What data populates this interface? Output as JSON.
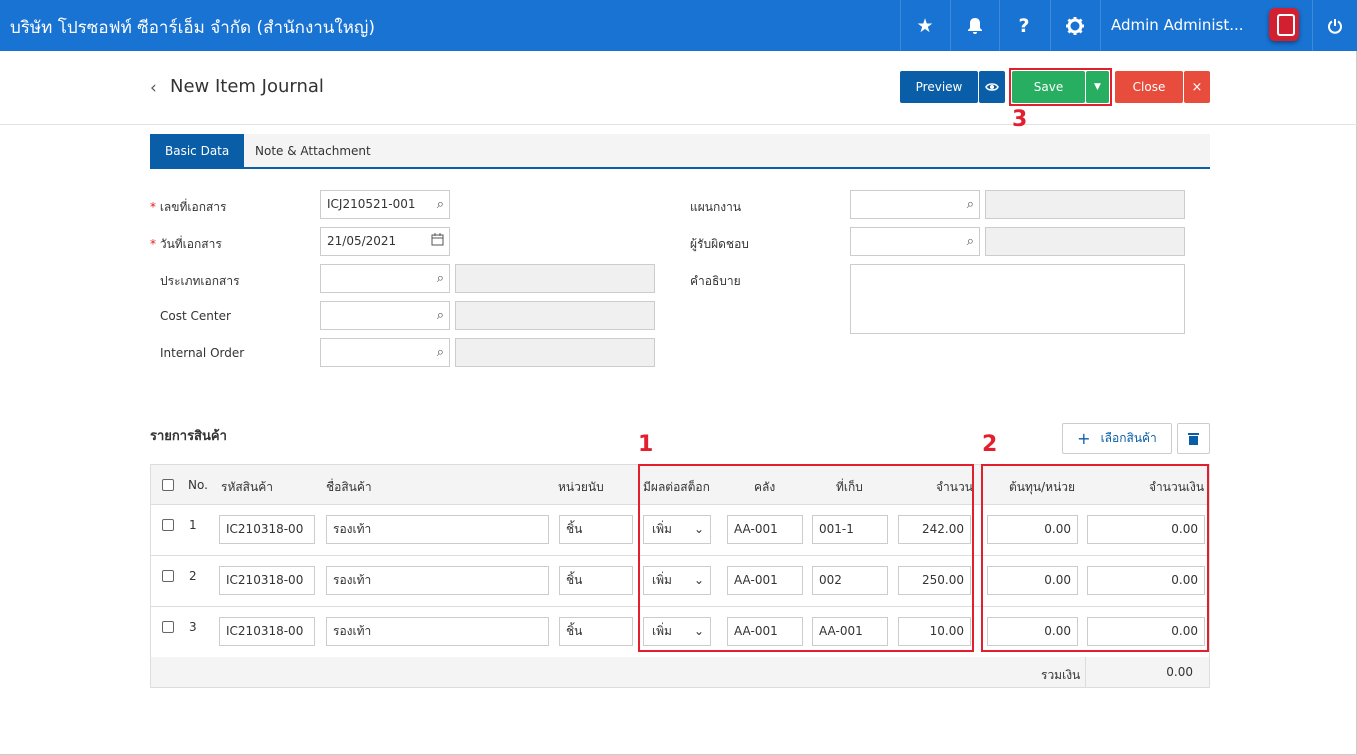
{
  "topbar": {
    "company": "บริษัท โปรซอฟท์ ซีอาร์เอ็ม จำกัด (สำนักงานใหญ่)",
    "user": "Admin Administ...",
    "icons": [
      "star-icon",
      "bell-icon",
      "question-icon",
      "gear-icon",
      "power-icon"
    ]
  },
  "header": {
    "title": "New Item Journal",
    "preview": "Preview",
    "save": "Save",
    "close": "Close"
  },
  "tabs": [
    "Basic Data",
    "Note & Attachment"
  ],
  "form": {
    "doc_no_label": "เลขที่เอกสาร",
    "doc_no": "ICJ210521-001",
    "doc_date_label": "วันที่เอกสาร",
    "doc_date": "21/05/2021",
    "doc_type_label": "ประเภทเอกสาร",
    "cost_center_label": "Cost Center",
    "internal_order_label": "Internal Order",
    "plan_label": "แผนกงาน",
    "responsible_label": "ผู้รับผิดชอบ",
    "description_label": "คำอธิบาย"
  },
  "items": {
    "section_title": "รายการสินค้า",
    "select_button": "เลือกสินค้า",
    "headers": {
      "no": "No.",
      "code": "รหัสสินค้า",
      "name": "ชื่อสินค้า",
      "unit": "หน่วยนับ",
      "effect": "มีผลต่อสต็อก",
      "warehouse": "คลัง",
      "location": "ที่เก็บ",
      "qty": "จำนวน",
      "unit_cost": "ต้นทุน/หน่วย",
      "amount": "จำนวนเงิน"
    },
    "rows": [
      {
        "no": "1",
        "code": "IC210318-00",
        "name": "รองเท้า",
        "unit": "ชิ้น",
        "effect": "เพิ่ม",
        "warehouse": "AA-001",
        "location": "001-1",
        "qty": "242.00",
        "unit_cost": "0.00",
        "amount": "0.00"
      },
      {
        "no": "2",
        "code": "IC210318-00",
        "name": "รองเท้า",
        "unit": "ชิ้น",
        "effect": "เพิ่ม",
        "warehouse": "AA-001",
        "location": "002",
        "qty": "250.00",
        "unit_cost": "0.00",
        "amount": "0.00"
      },
      {
        "no": "3",
        "code": "IC210318-00",
        "name": "รองเท้า",
        "unit": "ชิ้น",
        "effect": "เพิ่ม",
        "warehouse": "AA-001",
        "location": "AA-001",
        "qty": "10.00",
        "unit_cost": "0.00",
        "amount": "0.00"
      }
    ],
    "total_label": "รวมเงิน",
    "total": "0.00"
  },
  "annotations": [
    "1",
    "2",
    "3"
  ],
  "colors": {
    "topbar": "#1873d3",
    "preview": "#0a5ea8",
    "save": "#27ae60",
    "close": "#e74c3c",
    "annotation": "#e31e2e"
  }
}
